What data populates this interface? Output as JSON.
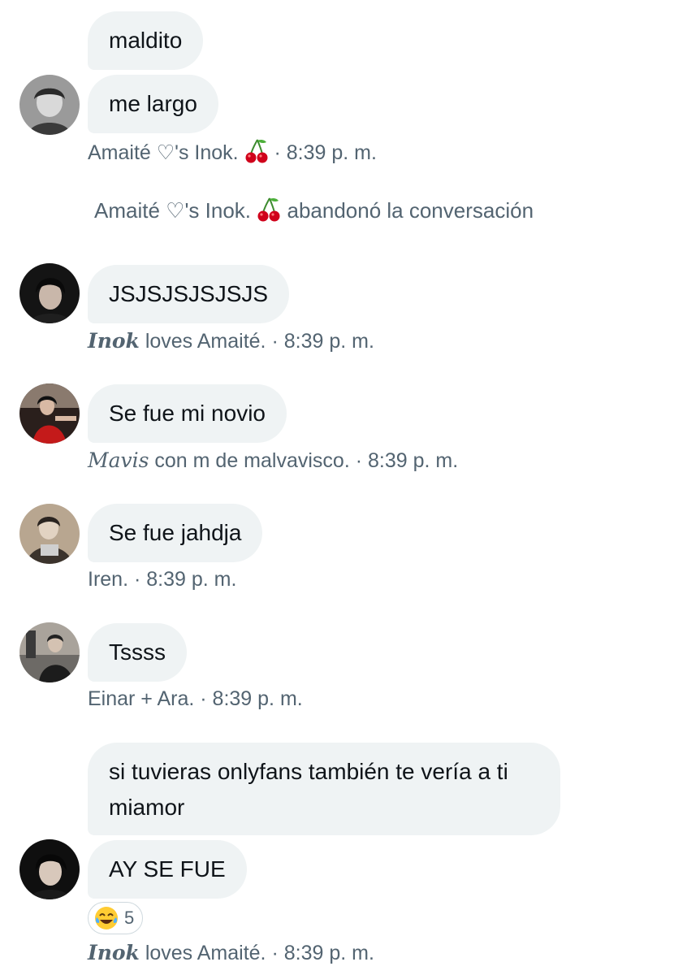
{
  "messages": {
    "m1": {
      "text": "maldito"
    },
    "m2": {
      "text": "me largo"
    },
    "m2_meta": {
      "name": "Amaité ♡'s Inok.",
      "emoji": "cherry-icon",
      "time": "· 8:39 p. m."
    },
    "system": {
      "name": "Amaité ♡'s Inok.",
      "emoji": "cherry-icon",
      "action": "abandonó la conversación"
    },
    "m3": {
      "text": "JSJSJSJSJSJS"
    },
    "m3_meta": {
      "name_styled": "Inok",
      "name_rest": " loves Amaité.",
      "time": "· 8:39 p. m."
    },
    "m4": {
      "text": "Se fue mi novio"
    },
    "m4_meta": {
      "name_styled": "Mavis",
      "name_rest": " con m de malvavisco.",
      "time": "· 8:39 p. m."
    },
    "m5": {
      "text": "Se fue jahdja"
    },
    "m5_meta": {
      "name": "Iren.",
      "time": "· 8:39 p. m."
    },
    "m6": {
      "text": "Tssss"
    },
    "m6_meta": {
      "name": "Einar + Ara.",
      "time": "· 8:39 p. m."
    },
    "m7": {
      "text": "si tuvieras onlyfans también te vería a ti miamor"
    },
    "m8": {
      "text": "AY SE FUE"
    },
    "m8_reaction": {
      "emoji": "tears-of-joy-icon",
      "count": "5"
    },
    "m8_meta": {
      "name_styled": "Inok",
      "name_rest": " loves Amaité.",
      "time": "· 8:39 p. m."
    }
  },
  "colors": {
    "bubble": "#eff3f4",
    "meta_text": "#536471",
    "text": "#0f1419",
    "cherry": "#d0021b"
  }
}
